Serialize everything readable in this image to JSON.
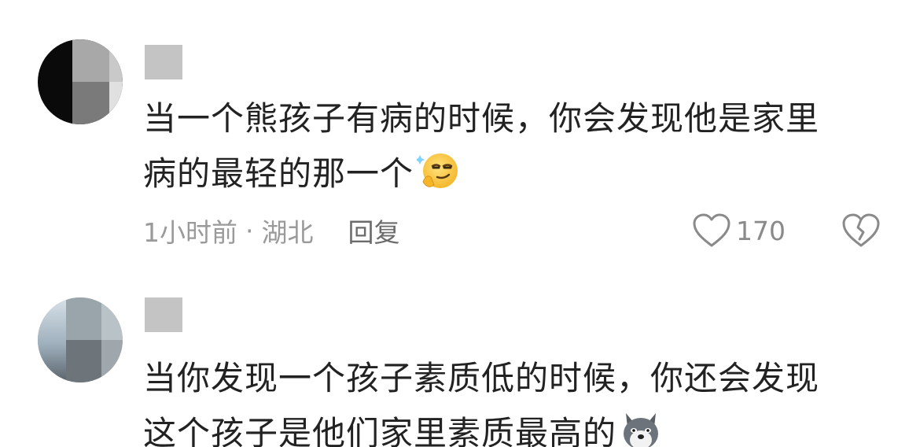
{
  "comments": [
    {
      "username": "",
      "text_lines": [
        "当一个熊孩子有病的时候，你会发现他是家里",
        "病的最轻的那一个"
      ],
      "emoji": "smirk-thinking-emoji",
      "time": "1小时前",
      "separator": "·",
      "location": "湖北",
      "reply_label": "回复",
      "like_count": "170"
    },
    {
      "username": "",
      "text_lines": [
        "当你发现一个孩子素质低的时候，你还会发现",
        "这个孩子是他们家里素质最高的"
      ],
      "emoji": "wolf-emoji"
    }
  ],
  "colors": {
    "text": "#222222",
    "meta": "#9a9a9a",
    "icon": "#8a8a8a"
  }
}
